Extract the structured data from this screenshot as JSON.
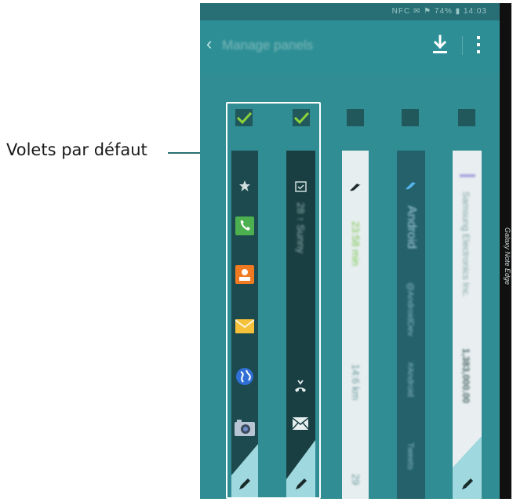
{
  "callout": {
    "label": "Volets par défaut"
  },
  "statusbar": {
    "text": "NFC ✉ ⚑ 74% ▮ 14:03"
  },
  "appbar": {
    "title": "Manage panels"
  },
  "device": {
    "edge_label": "Galaxy Note Edge"
  },
  "panels": [
    {
      "name": "app-shortcuts",
      "checked": true
    },
    {
      "name": "schedule",
      "checked": true
    },
    {
      "name": "twitter-1",
      "checked": false
    },
    {
      "name": "twitter-2",
      "checked": false
    },
    {
      "name": "stocks",
      "checked": false
    }
  ],
  "strip_text": {
    "schedule_1": "28 ↑ Sunny",
    "light_1": "23:58 min",
    "light_2": "14:6 km",
    "light_3": "29",
    "blue_1": "Android",
    "blue_2": "@AndroidDev",
    "blue_3": "#Android",
    "blue_4": "Tweets",
    "stocks_1": "Samsung Electronics Inc.",
    "stocks_2": "1,383,000.00"
  },
  "colors": {
    "accent": "#2f8d93",
    "check": "#8bd23a",
    "highlight": "#ffffff",
    "wedge": "#9fd8de"
  }
}
